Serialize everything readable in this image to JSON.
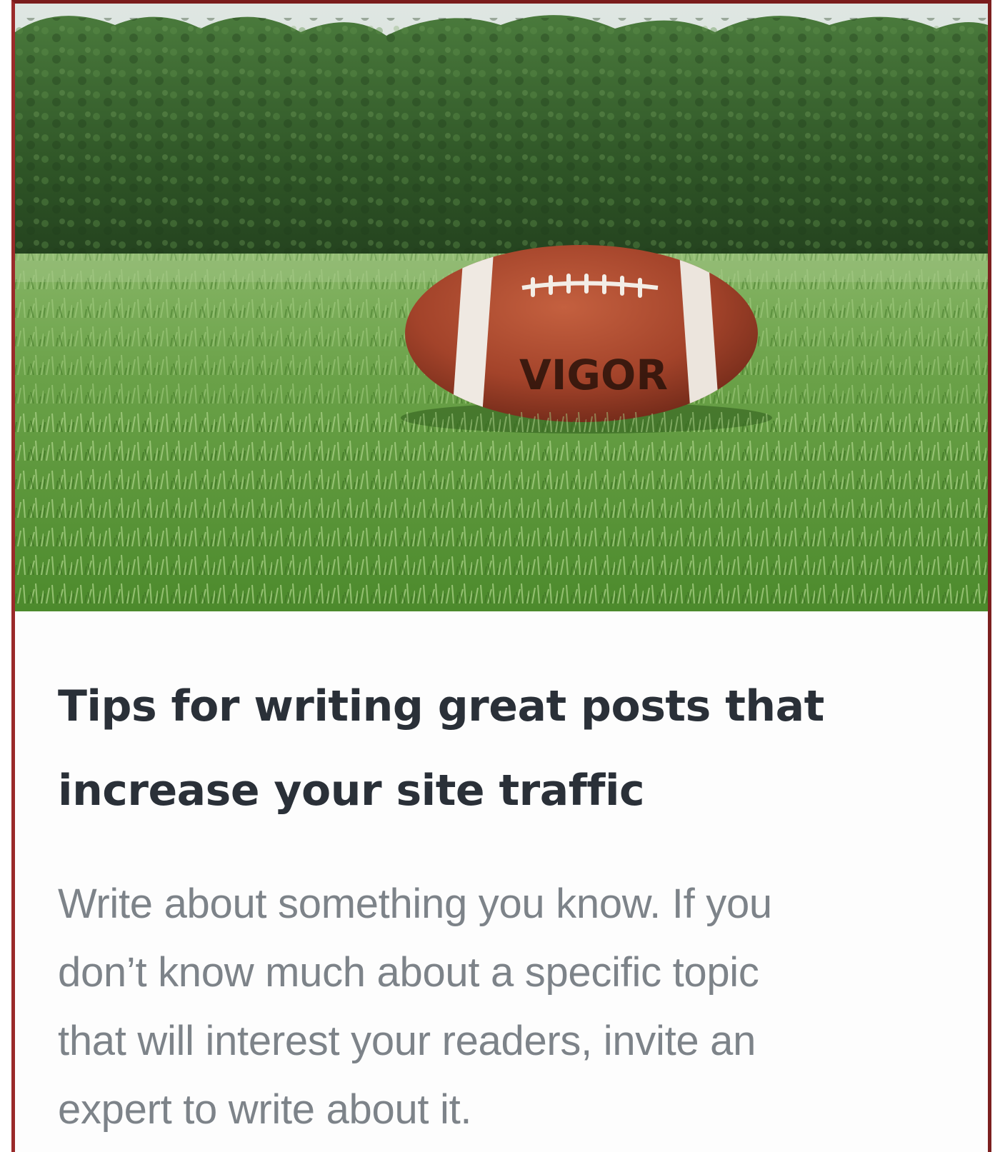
{
  "post": {
    "image": {
      "alt": "American football lying on green grass with trees in the background",
      "ball_print": "VIGOR"
    },
    "title_lines": [
      "Tips for writing great posts that",
      "increase your site traffic"
    ],
    "excerpt_lines": [
      "Write about something you know. If you",
      "don’t know much about a specific topic",
      "that will interest your readers, invite an",
      "expert to write about it."
    ]
  },
  "colors": {
    "card_border": "#8b2323",
    "title": "#2a3038",
    "excerpt": "#7d8389",
    "grass": "#5f9a3c",
    "trees": "#2f5d2a",
    "ball": "#a8442a"
  }
}
